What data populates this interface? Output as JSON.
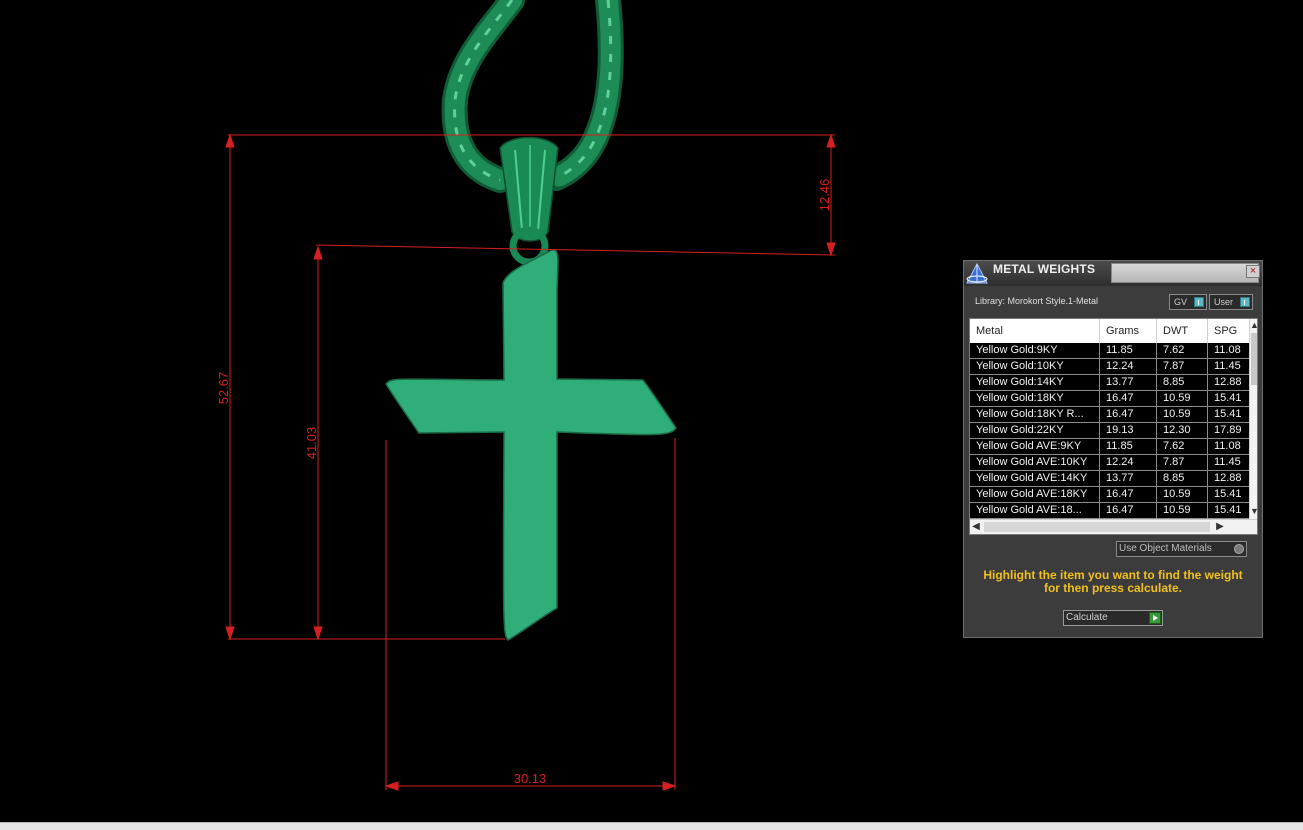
{
  "dimensions": {
    "height_bail": "12.46",
    "height_total": "52.67",
    "height_cross": "41.03",
    "width_cross": "30.13"
  },
  "panel": {
    "title": "METAL WEIGHTS",
    "close_label": "×",
    "library_label": "Library: Morokort Style.1-Metal",
    "toggle_gv": "GV",
    "toggle_user": "User",
    "columns": [
      "Metal",
      "Grams",
      "DWT",
      "SPG"
    ],
    "rows": [
      [
        "Yellow Gold:9KY",
        "11.85",
        "7.62",
        "11.08"
      ],
      [
        "Yellow Gold:10KY",
        "12.24",
        "7.87",
        "11.45"
      ],
      [
        "Yellow Gold:14KY",
        "13.77",
        "8.85",
        "12.88"
      ],
      [
        "Yellow Gold:18KY",
        "16.47",
        "10.59",
        "15.41"
      ],
      [
        "Yellow Gold:18KY R...",
        "16.47",
        "10.59",
        "15.41"
      ],
      [
        "Yellow Gold:22KY",
        "19.13",
        "12.30",
        "17.89"
      ],
      [
        "Yellow Gold AVE:9KY",
        "11.85",
        "7.62",
        "11.08"
      ],
      [
        "Yellow Gold AVE:10KY",
        "12.24",
        "7.87",
        "11.45"
      ],
      [
        "Yellow Gold AVE:14KY",
        "13.77",
        "8.85",
        "12.88"
      ],
      [
        "Yellow Gold AVE:18KY",
        "16.47",
        "10.59",
        "15.41"
      ],
      [
        "Yellow Gold AVE:18...",
        "16.47",
        "10.59",
        "15.41"
      ]
    ],
    "use_object_materials": "Use Object Materials",
    "hint": "Highlight the item you want to find the weight for then press calculate.",
    "calculate_label": "Calculate"
  },
  "colors": {
    "background": "#000000",
    "dimension_lines": "#d42020",
    "pendant": "#2fae7a",
    "chain": "#1c8a55",
    "hint_text": "#f0c020"
  }
}
